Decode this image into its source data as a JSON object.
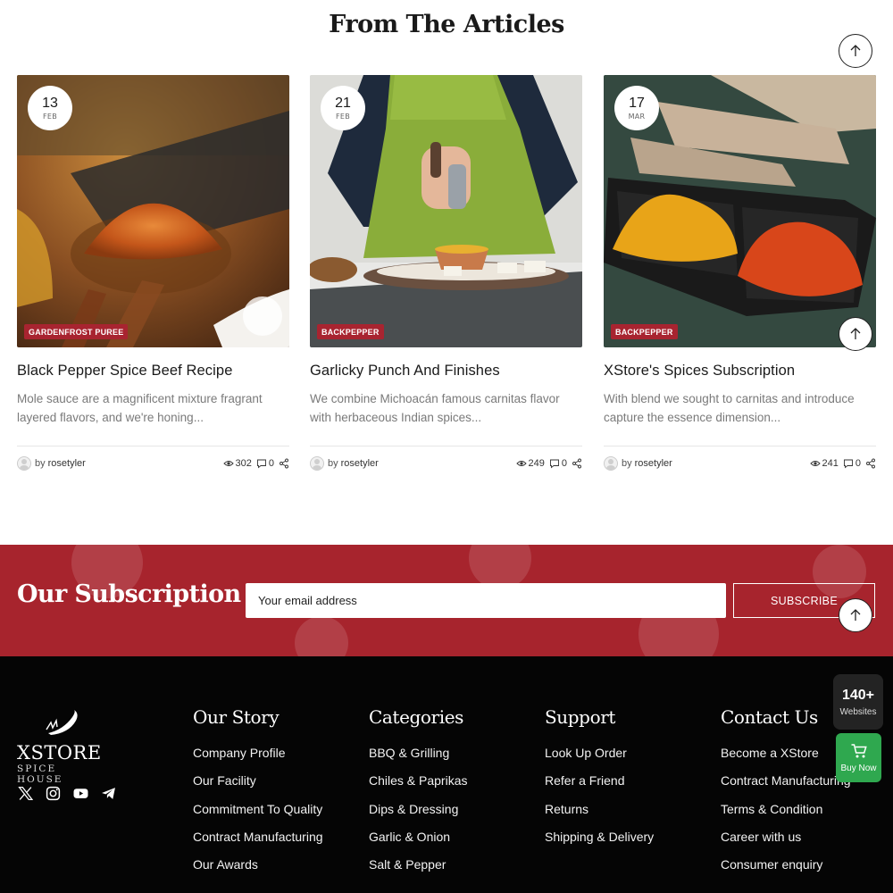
{
  "section": {
    "title": "From The Articles"
  },
  "articles": [
    {
      "day": "13",
      "month": "FEB",
      "category": "GARDENFROST PUREE",
      "title": "Black Pepper Spice Beef Recipe",
      "excerpt": "Mole sauce are a magnificent mixture fragrant layered flavors, and we're honing...",
      "by": "by",
      "author": "rosetyler",
      "views": "302",
      "comments": "0"
    },
    {
      "day": "21",
      "month": "FEB",
      "category": "BACKPEPPER",
      "title": "Garlicky Punch And Finishes",
      "excerpt": "We combine Michoacán famous carnitas flavor with herbaceous Indian spices...",
      "by": "by",
      "author": "rosetyler",
      "views": "249",
      "comments": "0"
    },
    {
      "day": "17",
      "month": "MAR",
      "category": "BACKPEPPER",
      "title": "XStore's Spices Subscription",
      "excerpt": "With blend we sought to carnitas and introduce capture the essence dimension...",
      "by": "by",
      "author": "rosetyler",
      "views": "241",
      "comments": "0"
    }
  ],
  "subscription": {
    "title": "Our Subscription",
    "placeholder": "Your email address",
    "button": "SUBSCRIBE"
  },
  "footer": {
    "logo_name": "XSTORE",
    "logo_sub": "SPICE HOUSE",
    "socials": [
      "x-icon",
      "instagram-icon",
      "youtube-icon",
      "telegram-icon"
    ],
    "columns": [
      {
        "title": "Our Story",
        "items": [
          "Company Profile",
          "Our Facility",
          "Commitment To Quality",
          "Contract Manufacturing",
          "Our Awards"
        ]
      },
      {
        "title": "Categories",
        "items": [
          "BBQ & Grilling",
          "Chiles & Paprikas",
          "Dips & Dressing",
          "Garlic & Onion",
          "Salt & Pepper"
        ]
      },
      {
        "title": "Support",
        "items": [
          "Look Up Order",
          "Refer a Friend",
          "Returns",
          "Shipping & Delivery"
        ]
      },
      {
        "title": "Contact Us",
        "items": [
          "Become a XStore",
          "Contract Manufacturing",
          "Terms & Condition",
          "Career with us",
          "Consumer enquiry"
        ]
      }
    ]
  },
  "widgets": {
    "websites_count": "140+",
    "websites_label": "Websites",
    "buy_label": "Buy Now"
  },
  "colors": {
    "accent": "#a7242d",
    "tag": "#a82430",
    "footer_bg": "#050505",
    "buy_green": "#2fa84f"
  }
}
